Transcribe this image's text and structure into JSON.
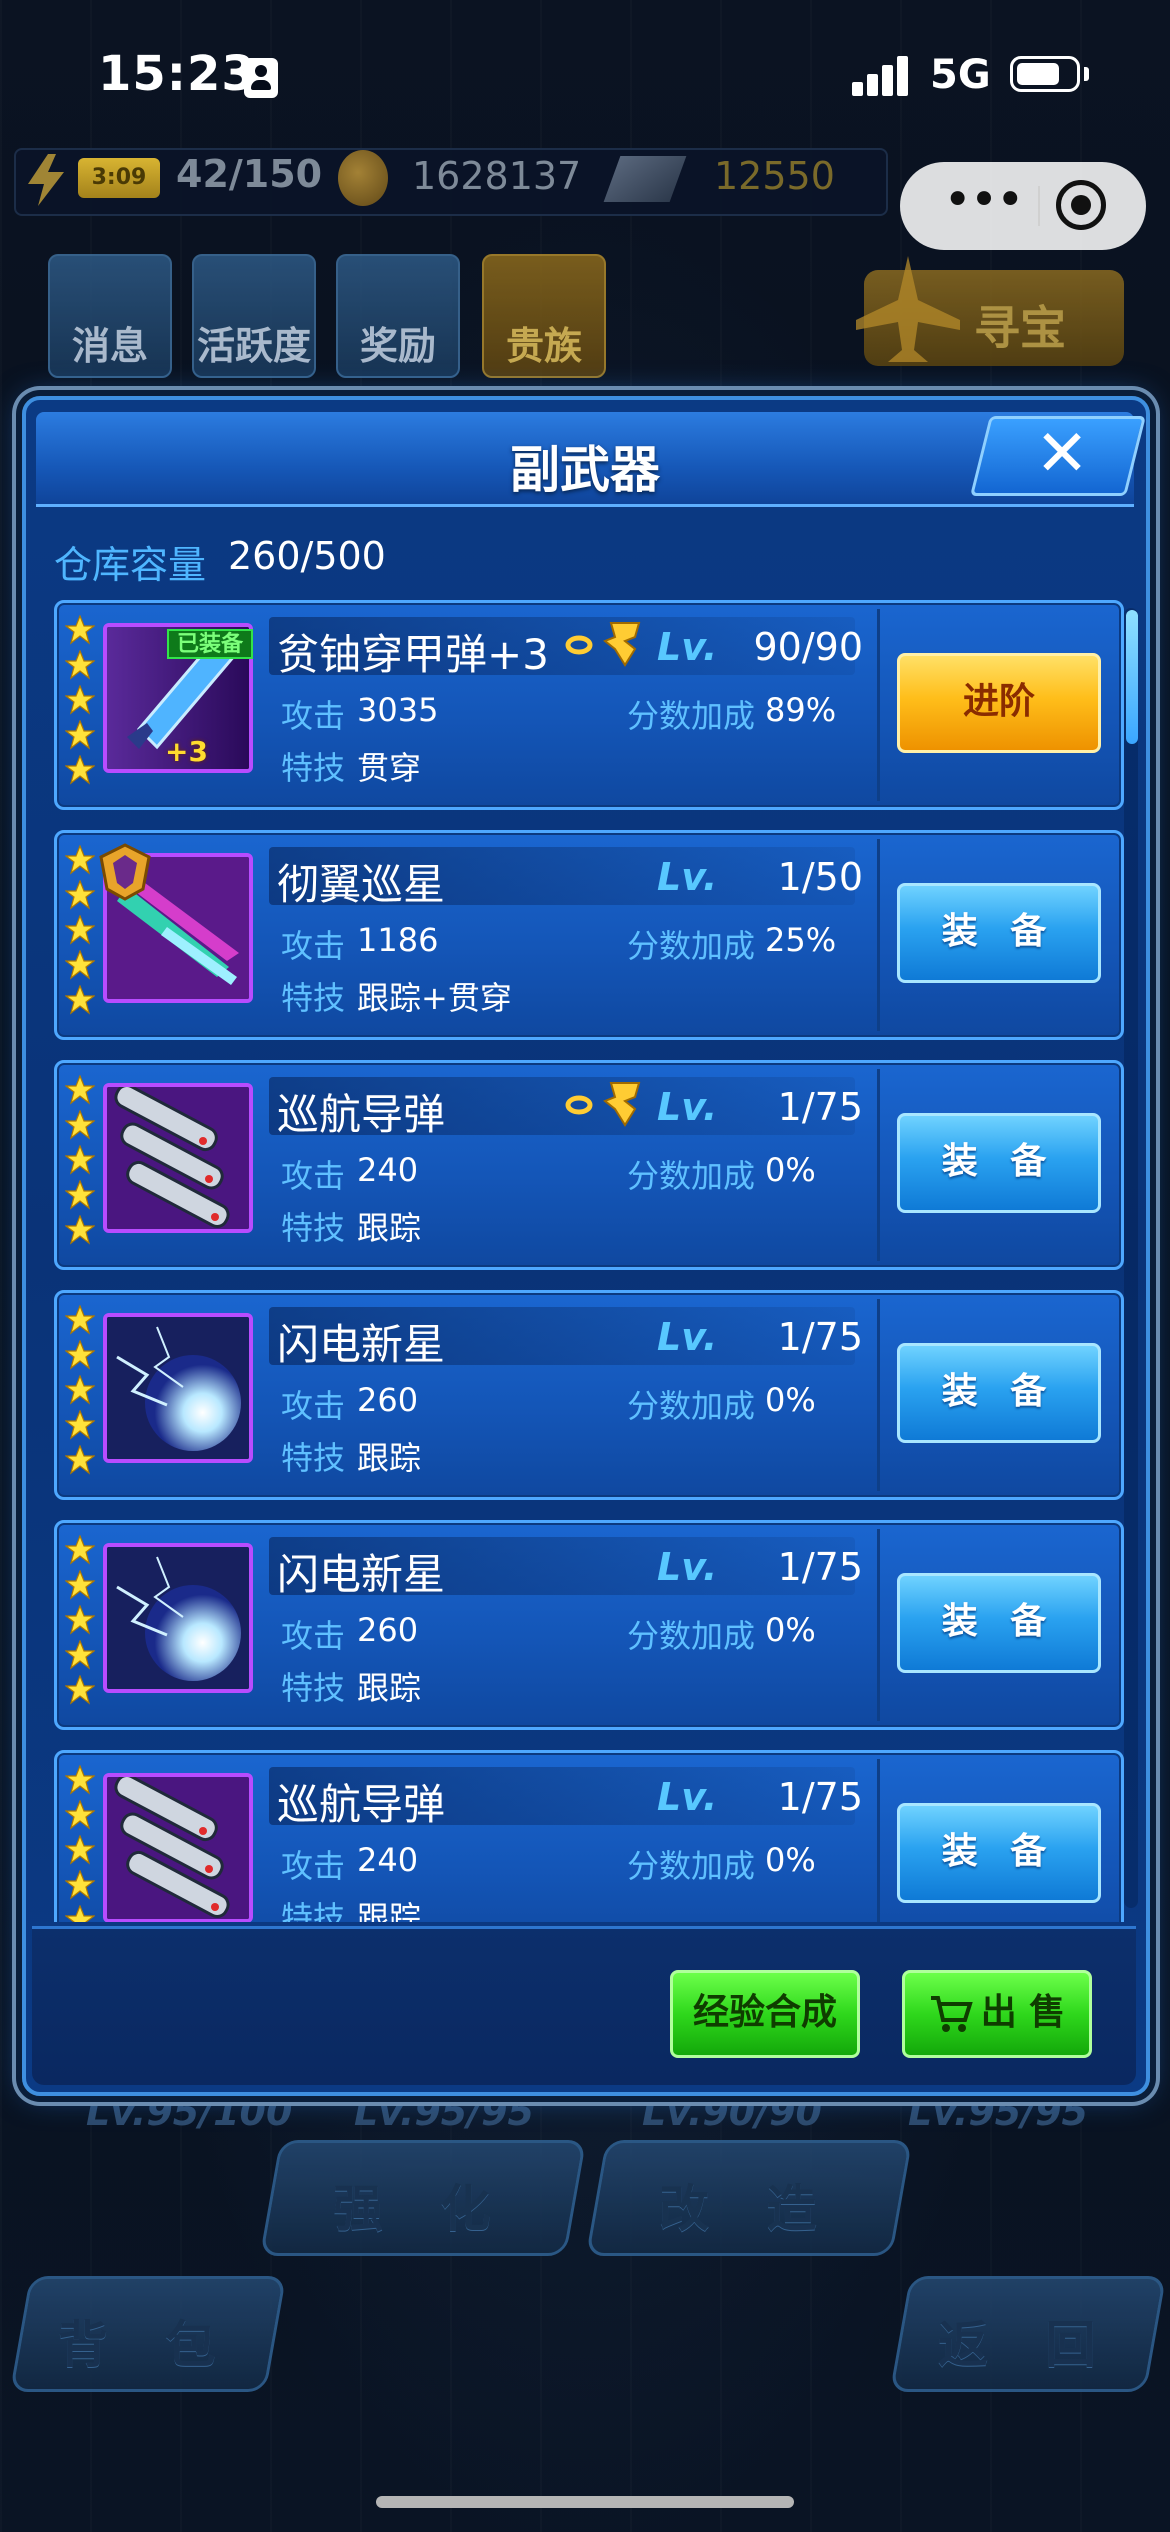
{
  "status_bar": {
    "time": "15:23",
    "network": "5G",
    "battery_level": 0.75
  },
  "resources": {
    "energy_timer": "3:09",
    "energy": "42/150",
    "coins": "1628137",
    "gems": "12550"
  },
  "top_buttons": [
    {
      "label": "消息",
      "icon": "message-icon"
    },
    {
      "label": "活跃度",
      "icon": "smile-badge-icon"
    },
    {
      "label": "奖励",
      "icon": "gift-icon"
    },
    {
      "label": "贵族",
      "icon": "vip-icon"
    }
  ],
  "treasure_button": {
    "label": "寻宝",
    "icon": "jet-icon"
  },
  "background": {
    "levels": [
      "Lv.95/100",
      "Lv.95/95",
      "Lv.90/90",
      "Lv.95/95"
    ],
    "lower_buttons": [
      "强 化",
      "改 造",
      "背 包",
      "返 回"
    ]
  },
  "dialog": {
    "title": "副武器",
    "close_icon": "close-icon",
    "capacity_label": "仓库容量",
    "capacity_value": "260/500",
    "lv_label": "Lv.",
    "attack_label": "攻击",
    "score_label": "分数加成",
    "skill_label": "特技",
    "equipped_tag": "已装备",
    "items": [
      {
        "name": "贫铀穿甲弹+3",
        "lv": "90/90",
        "attack": "3035",
        "score": "89%",
        "skill": "贯穿",
        "stars": 5,
        "equipped": true,
        "plus": "+3",
        "button": "进阶",
        "thumb": "shell",
        "link": true,
        "rank": false
      },
      {
        "name": "彻翼巡星",
        "lv": "1/50",
        "attack": "1186",
        "score": "25%",
        "skill": "跟踪+贯穿",
        "stars": 5,
        "equipped": false,
        "button": "装 备",
        "thumb": "wings",
        "link": false,
        "rank": true
      },
      {
        "name": "巡航导弹",
        "lv": "1/75",
        "attack": "240",
        "score": "0%",
        "skill": "跟踪",
        "stars": 5,
        "equipped": false,
        "button": "装 备",
        "thumb": "missiles",
        "link": true,
        "rank": false
      },
      {
        "name": "闪电新星",
        "lv": "1/75",
        "attack": "260",
        "score": "0%",
        "skill": "跟踪",
        "stars": 5,
        "equipped": false,
        "button": "装 备",
        "thumb": "lightning",
        "link": false,
        "rank": false
      },
      {
        "name": "闪电新星",
        "lv": "1/75",
        "attack": "260",
        "score": "0%",
        "skill": "跟踪",
        "stars": 5,
        "equipped": false,
        "button": "装 备",
        "thumb": "lightning",
        "link": false,
        "rank": false
      },
      {
        "name": "巡航导弹",
        "lv": "1/75",
        "attack": "240",
        "score": "0%",
        "skill": "跟踪",
        "stars": 5,
        "equipped": false,
        "button": "装 备",
        "thumb": "missiles",
        "link": false,
        "rank": false
      }
    ],
    "footer": {
      "exp_combine": "经验合成",
      "sell": "出 售",
      "sell_icon": "cart-icon"
    }
  }
}
